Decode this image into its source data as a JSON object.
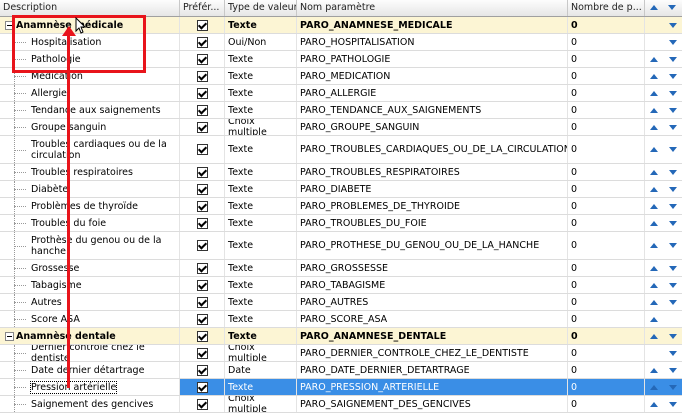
{
  "columns": {
    "description": "Description",
    "pref": "Préfér...",
    "type": "Type de valeur",
    "nom": "Nom paramètre",
    "nb": "Nombre de p..."
  },
  "rows": [
    {
      "group": true,
      "desc": "Anamnèse médicale",
      "type": "Texte",
      "nom": "PARO_ANAMNESE_MEDICALE",
      "nb": "0",
      "up": false,
      "down": true
    },
    {
      "desc": "Hospitalisation",
      "type": "Oui/Non",
      "nom": "PARO_HOSPITALISATION",
      "nb": "0",
      "up": false,
      "down": true
    },
    {
      "desc": "Pathologie",
      "type": "Texte",
      "nom": "PARO_PATHOLOGIE",
      "nb": "0",
      "up": true,
      "down": true
    },
    {
      "desc": "Médication",
      "type": "Texte",
      "nom": "PARO_MEDICATION",
      "nb": "0",
      "up": true,
      "down": true
    },
    {
      "desc": "Allergie",
      "type": "Texte",
      "nom": "PARO_ALLERGIE",
      "nb": "0",
      "up": true,
      "down": true
    },
    {
      "desc": "Tendance aux saignements",
      "type": "Texte",
      "nom": "PARO_TENDANCE_AUX_SAIGNEMENTS",
      "nb": "0",
      "up": true,
      "down": true
    },
    {
      "desc": "Groupe sanguin",
      "type": "Choix multiple",
      "nom": "PARO_GROUPE_SANGUIN",
      "nb": "0",
      "up": true,
      "down": true
    },
    {
      "desc": "Troubles cardiaques ou de la circulation",
      "type": "Texte",
      "nom": "PARO_TROUBLES_CARDIAQUES_OU_DE_LA_CIRCULATION",
      "nb": "0",
      "up": true,
      "down": true,
      "tall": true
    },
    {
      "desc": "Troubles respiratoires",
      "type": "Texte",
      "nom": "PARO_TROUBLES_RESPIRATOIRES",
      "nb": "0",
      "up": true,
      "down": true
    },
    {
      "desc": "Diabète",
      "type": "Texte",
      "nom": "PARO_DIABETE",
      "nb": "0",
      "up": true,
      "down": true
    },
    {
      "desc": "Problèmes de thyroïde",
      "type": "Texte",
      "nom": "PARO_PROBLEMES_DE_THYROIDE",
      "nb": "0",
      "up": true,
      "down": true
    },
    {
      "desc": "Troubles du foie",
      "type": "Texte",
      "nom": "PARO_TROUBLES_DU_FOIE",
      "nb": "0",
      "up": true,
      "down": true
    },
    {
      "desc": "Prothèse du genou ou de la hanche",
      "type": "Texte",
      "nom": "PARO_PROTHESE_DU_GENOU_OU_DE_LA_HANCHE",
      "nb": "0",
      "up": true,
      "down": true,
      "tall": true
    },
    {
      "desc": "Grossesse",
      "type": "Texte",
      "nom": "PARO_GROSSESSE",
      "nb": "0",
      "up": true,
      "down": true
    },
    {
      "desc": "Tabagisme",
      "type": "Texte",
      "nom": "PARO_TABAGISME",
      "nb": "0",
      "up": true,
      "down": true
    },
    {
      "desc": "Autres",
      "type": "Texte",
      "nom": "PARO_AUTRES",
      "nb": "0",
      "up": true,
      "down": true
    },
    {
      "desc": "Score ASA",
      "type": "Texte",
      "nom": "PARO_SCORE_ASA",
      "nb": "0",
      "up": true,
      "down": false
    },
    {
      "group": true,
      "desc": "Anamnèse dentale",
      "type": "Texte",
      "nom": "PARO_ANAMNESE_DENTALE",
      "nb": "0",
      "up": true,
      "down": true
    },
    {
      "desc": "Dernier contrôle chez le dentiste",
      "type": "Choix multiple",
      "nom": "PARO_DERNIER_CONTROLE_CHEZ_LE_DENTISTE",
      "nb": "0",
      "up": false,
      "down": true
    },
    {
      "desc": "Date dernier détartrage",
      "type": "Date",
      "nom": "PARO_DATE_DERNIER_DETARTRAGE",
      "nb": "0",
      "up": true,
      "down": true
    },
    {
      "desc": "Pression artérielle",
      "type": "Texte",
      "nom": "PARO_PRESSION_ARTERIELLE",
      "nb": "0",
      "up": true,
      "down": true,
      "selected": true
    },
    {
      "desc": "Saignement des gencives",
      "type": "Choix multiple",
      "nom": "PARO_SAIGNEMENT_DES_GENCIVES",
      "nb": "0",
      "up": true,
      "down": true
    }
  ],
  "colors": {
    "accent": "#2468b8",
    "selection": "#3a8ee6",
    "group_bg": "#fcf5d4",
    "annotation": "#e8141b"
  }
}
